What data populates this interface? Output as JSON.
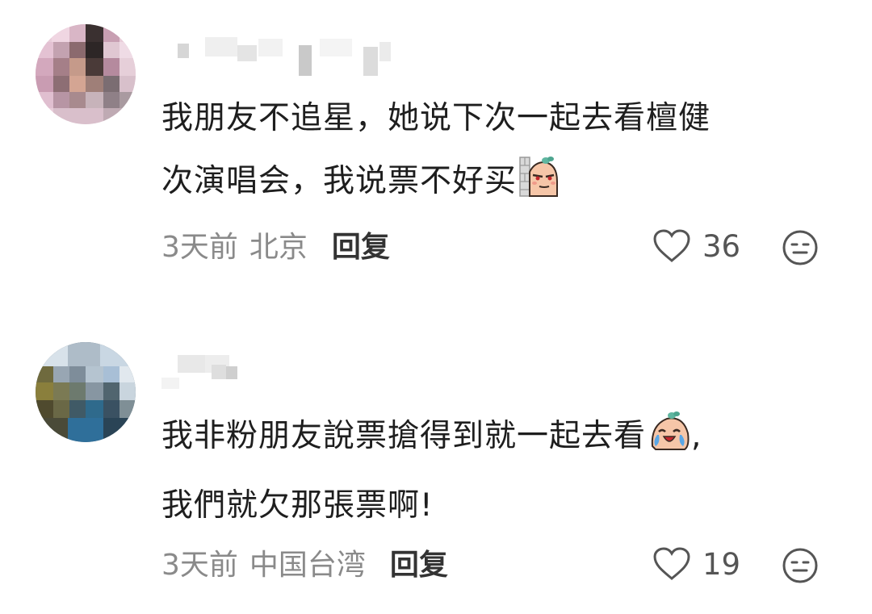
{
  "comments": [
    {
      "lines": [
        "我朋友不追星，她说下次一起去看檀健",
        "次演唱会，我说票不好买"
      ],
      "emoji": "wall-peek-emoji",
      "time": "3天前",
      "location": "北京",
      "reply_label": "回复",
      "likes": "36"
    },
    {
      "lines": [
        "我非粉朋友說票搶得到就一起去看",
        "我們就欠那張票啊!"
      ],
      "line1_suffix": ",",
      "emoji": "crying-laugh-emoji",
      "time": "3天前",
      "location": "中国台湾",
      "reply_label": "回复",
      "likes": "19"
    }
  ],
  "colors": {
    "text": "#1e1e1e",
    "meta": "#8a8a8a",
    "reply": "#333333",
    "icon": "#555555"
  }
}
